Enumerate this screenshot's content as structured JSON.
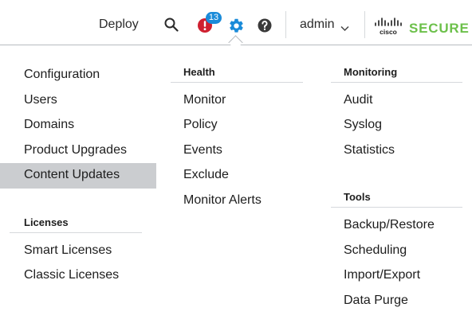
{
  "topbar": {
    "deploy_label": "Deploy",
    "notifications_count": "13",
    "user_label": "admin",
    "brand_cisco": "cisco",
    "brand_secure": "SECURE"
  },
  "menu": {
    "col1": {
      "items": [
        "Configuration",
        "Users",
        "Domains",
        "Product Upgrades",
        "Content Updates"
      ],
      "active_item": "Content Updates",
      "licenses_heading": "Licenses",
      "licenses_items": [
        "Smart Licenses",
        "Classic Licenses"
      ]
    },
    "col2": {
      "health_heading": "Health",
      "health_items": [
        "Monitor",
        "Policy",
        "Events",
        "Exclude",
        "Monitor Alerts"
      ]
    },
    "col3": {
      "monitoring_heading": "Monitoring",
      "monitoring_items": [
        "Audit",
        "Syslog",
        "Statistics"
      ],
      "tools_heading": "Tools",
      "tools_items": [
        "Backup/Restore",
        "Scheduling",
        "Import/Export",
        "Data Purge"
      ]
    }
  },
  "colors": {
    "accent": "#1a8bd9",
    "alert": "#cf2030",
    "brand_green": "#6cc04a",
    "active_bg": "#cbcdd0"
  }
}
